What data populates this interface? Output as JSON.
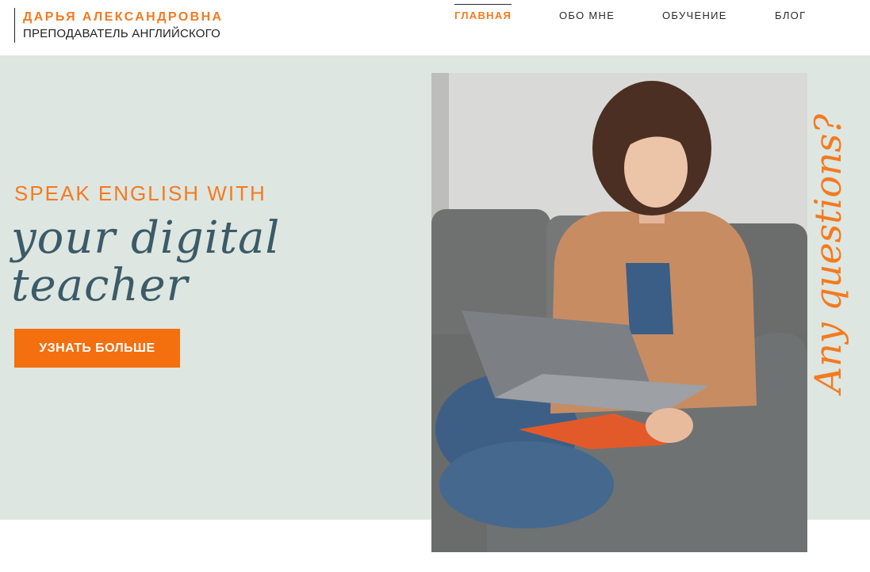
{
  "brand": {
    "name": "ДАРЬЯ АЛЕКСАНДРОВНА",
    "subtitle": "ПРЕПОДАВАТЕЛЬ АНГЛИЙСКОГО"
  },
  "nav": {
    "items": [
      {
        "label": "ГЛАВНАЯ",
        "active": true
      },
      {
        "label": "ОБО МНЕ",
        "active": false
      },
      {
        "label": "ОБУЧЕНИЕ",
        "active": false
      },
      {
        "label": "БЛОГ",
        "active": false
      }
    ]
  },
  "hero": {
    "tagline": "SPEAK ENGLISH WITH",
    "script_line_1": "your digital",
    "script_line_2": "teacher",
    "cta_label": "УЗНАТЬ БОЛЬШЕ",
    "side_text": "Any questions?"
  },
  "colors": {
    "accent": "#f47a20",
    "hero_bg": "#dde6e0",
    "script_text": "#3c5a68"
  },
  "icons": {
    "photo": "teacher-photo"
  }
}
